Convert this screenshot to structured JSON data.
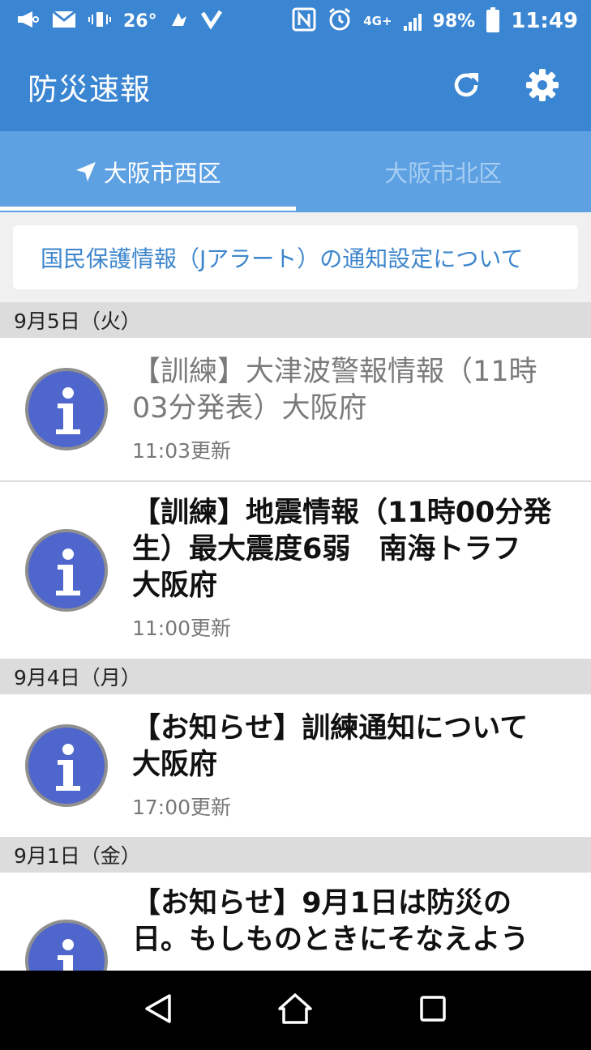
{
  "status_bar": {
    "temperature": "26°",
    "network": "4G+",
    "battery": "98%",
    "time": "11:49",
    "icons": [
      "megaphone-icon",
      "mail-icon",
      "vibrate-icon",
      "temperature-icon",
      "app-icon",
      "check-icon",
      "nfc-icon",
      "alarm-icon",
      "signal-icon",
      "battery-icon"
    ]
  },
  "app_bar": {
    "title": "防災速報",
    "refresh_icon": "refresh-icon",
    "settings_icon": "gear-icon"
  },
  "tabs": [
    {
      "label": "大阪市西区",
      "active": true,
      "icon": "location-arrow-icon"
    },
    {
      "label": "大阪市北区",
      "active": false
    }
  ],
  "notice": {
    "text": "国民保護情報（Jアラート）の通知設定について"
  },
  "sections": [
    {
      "date": "9月5日（火）",
      "items": [
        {
          "title": "【訓練】大津波警報情報（11時03分発表）大阪府",
          "time": "11:03更新",
          "read": true
        },
        {
          "title": "【訓練】地震情報（11時00分発生）最大震度6弱　南海トラフ　大阪府",
          "time": "11:00更新",
          "read": false
        }
      ]
    },
    {
      "date": "9月4日（月）",
      "items": [
        {
          "title": "【お知らせ】訓練通知について　大阪府",
          "time": "17:00更新",
          "read": false
        }
      ]
    },
    {
      "date": "9月1日（金）",
      "items": [
        {
          "title": "【お知らせ】9月1日は防災の日。もしものときにそなえよう",
          "time": "",
          "read": false
        }
      ]
    }
  ],
  "colors": {
    "primary": "#3b86d2",
    "tab_bar": "#5ea1e3",
    "info_icon": "#4f66cc",
    "notice_text": "#3d86cc"
  },
  "nav_bar": {
    "icons": [
      "back-icon",
      "home-icon",
      "recents-icon"
    ]
  }
}
